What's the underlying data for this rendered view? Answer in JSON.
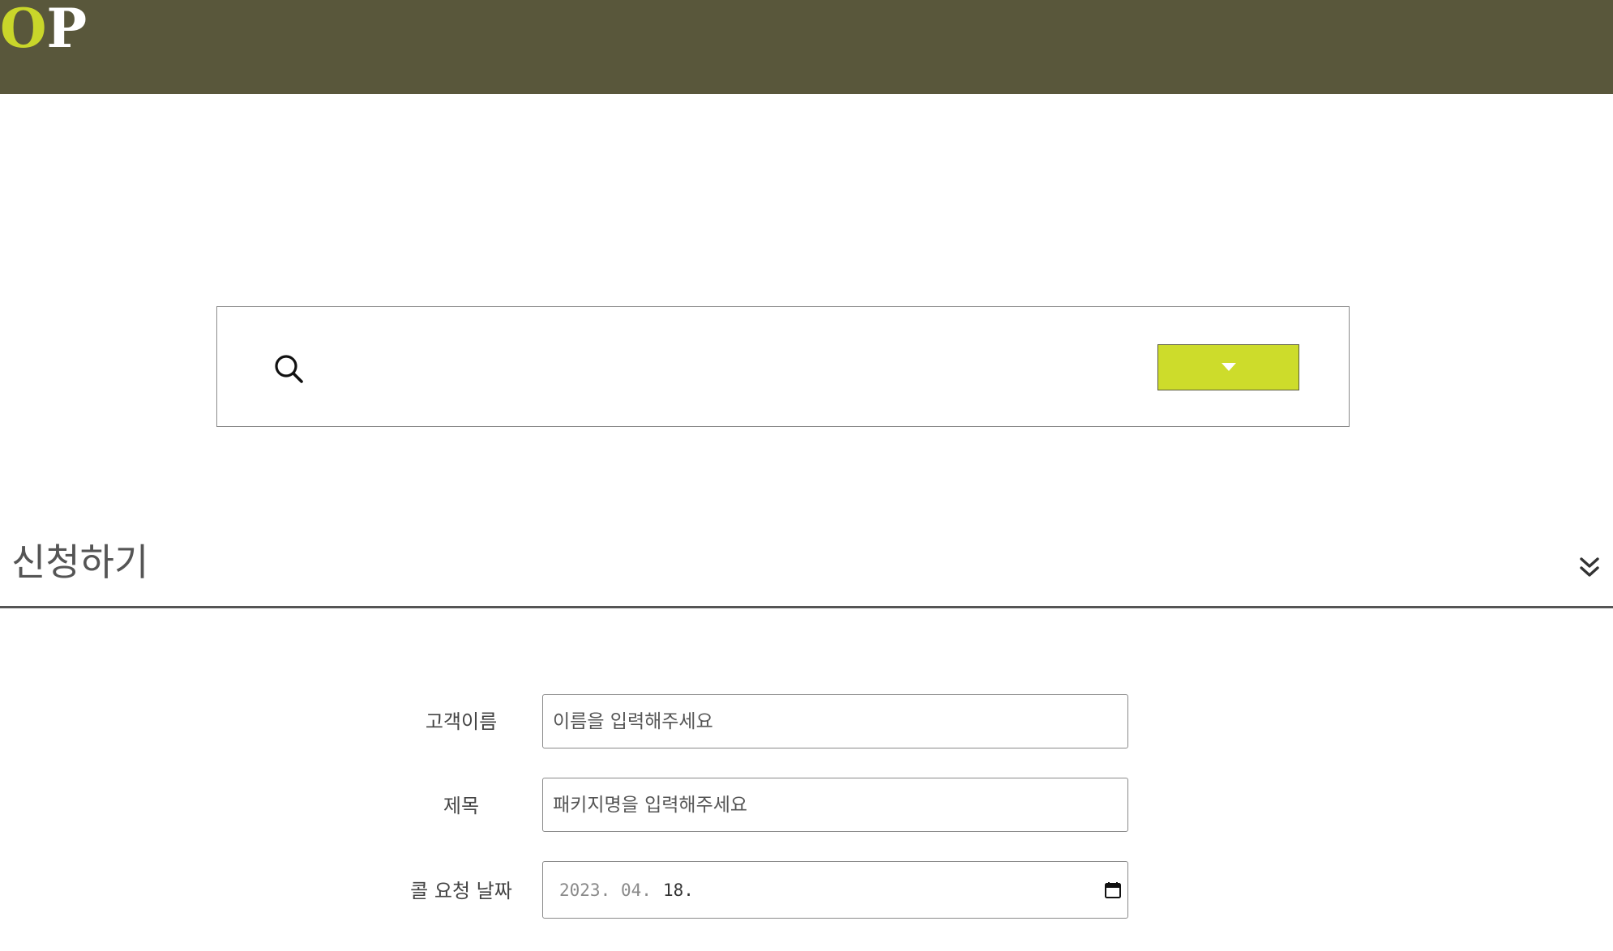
{
  "header": {
    "logo_letter_1": "O",
    "logo_letter_2": "P",
    "background_color": "#59573b",
    "logo_accent_color": "#c9d62a"
  },
  "search": {
    "icon": "search-icon",
    "value": "",
    "dropdown_icon": "caret-down-icon",
    "dropdown_color": "#cddc2b"
  },
  "section": {
    "title": "신청하기",
    "toggle_icon": "double-chevron-down-icon"
  },
  "form": {
    "customer_name": {
      "label": "고객이름",
      "placeholder": "이름을 입력해주세요",
      "value": ""
    },
    "title": {
      "label": "제목",
      "placeholder": "패키지명을 입력해주세요",
      "value": ""
    },
    "call_request_date": {
      "label": "콜 요청 날짜",
      "year": "2023",
      "month": "04",
      "day": "18",
      "icon": "calendar-icon"
    }
  }
}
